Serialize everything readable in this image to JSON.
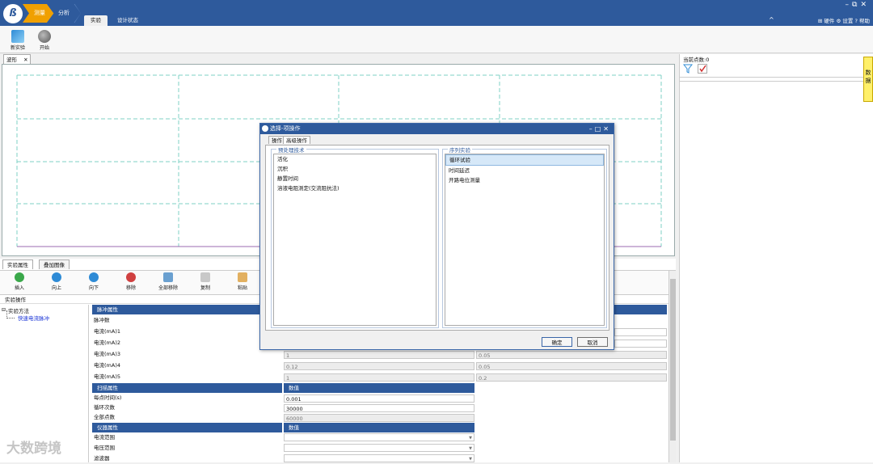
{
  "title_bar": {
    "breadcrumb": [
      "测量",
      "分析"
    ],
    "ribbon_tabs": [
      "实验",
      "设计状态"
    ],
    "right_tools": [
      "硬件",
      "设置",
      "帮助"
    ],
    "window_buttons": [
      "–",
      "⧉",
      "✕"
    ]
  },
  "ribbon": {
    "new_experiment": "新实验",
    "start": "开始"
  },
  "wave": {
    "tab_label": "波形",
    "tab_close": "✕"
  },
  "right_panel": {
    "point_count": "当前点数:0",
    "side_tab": "数据"
  },
  "properties": {
    "tabs": [
      "实验属性",
      "叠加图像"
    ],
    "toolbar": [
      "插入",
      "向上",
      "向下",
      "移除",
      "全部移除",
      "复制",
      "粘贴"
    ],
    "section_label": "实验操作",
    "tree": {
      "root": "实验方法",
      "child": "快速电流脉冲"
    },
    "pulse": {
      "header": "脉冲属性",
      "rows": [
        {
          "label": "脉冲数",
          "v1": "",
          "v2": ""
        },
        {
          "label": "电流(mA)1",
          "v1": "",
          "v2": ""
        },
        {
          "label": "电流(mA)2",
          "v1": "",
          "v2": ""
        },
        {
          "label": "电流(mA)3",
          "v1": "1",
          "v2": "0.05"
        },
        {
          "label": "电流(mA)4",
          "v1": "0.12",
          "v2": "0.05"
        },
        {
          "label": "电流(mA)5",
          "v1": "1",
          "v2": "0.2"
        }
      ]
    },
    "scan": {
      "header": "扫描属性",
      "value_header": "数值",
      "rows": [
        {
          "label": "每点时间(s)",
          "value": "0.001"
        },
        {
          "label": "循环次数",
          "value": "30000"
        },
        {
          "label": "全部点数",
          "value": "60000"
        }
      ]
    },
    "instrument": {
      "header": "仪器属性",
      "value_header": "数值",
      "rows": [
        {
          "label": "电流范围",
          "value": ""
        },
        {
          "label": "电压范围",
          "value": ""
        },
        {
          "label": "滤波器",
          "value": ""
        }
      ]
    }
  },
  "dialog": {
    "title": "选择-项操作",
    "window_buttons": [
      "–",
      "□",
      "✕"
    ],
    "tabs": [
      "操作",
      "高级操作"
    ],
    "left_group": {
      "title": "预处理技术",
      "items": [
        "活化",
        "沉积",
        "静置时间",
        "溶液电阻测定(交流阻抗法)"
      ]
    },
    "right_group": {
      "title": "序列实验",
      "items": [
        "循环试验",
        "时间延迟",
        "开路电位测量"
      ],
      "selected": 0
    },
    "ok": "确定",
    "cancel": "取消"
  },
  "watermark": "大数跨境"
}
